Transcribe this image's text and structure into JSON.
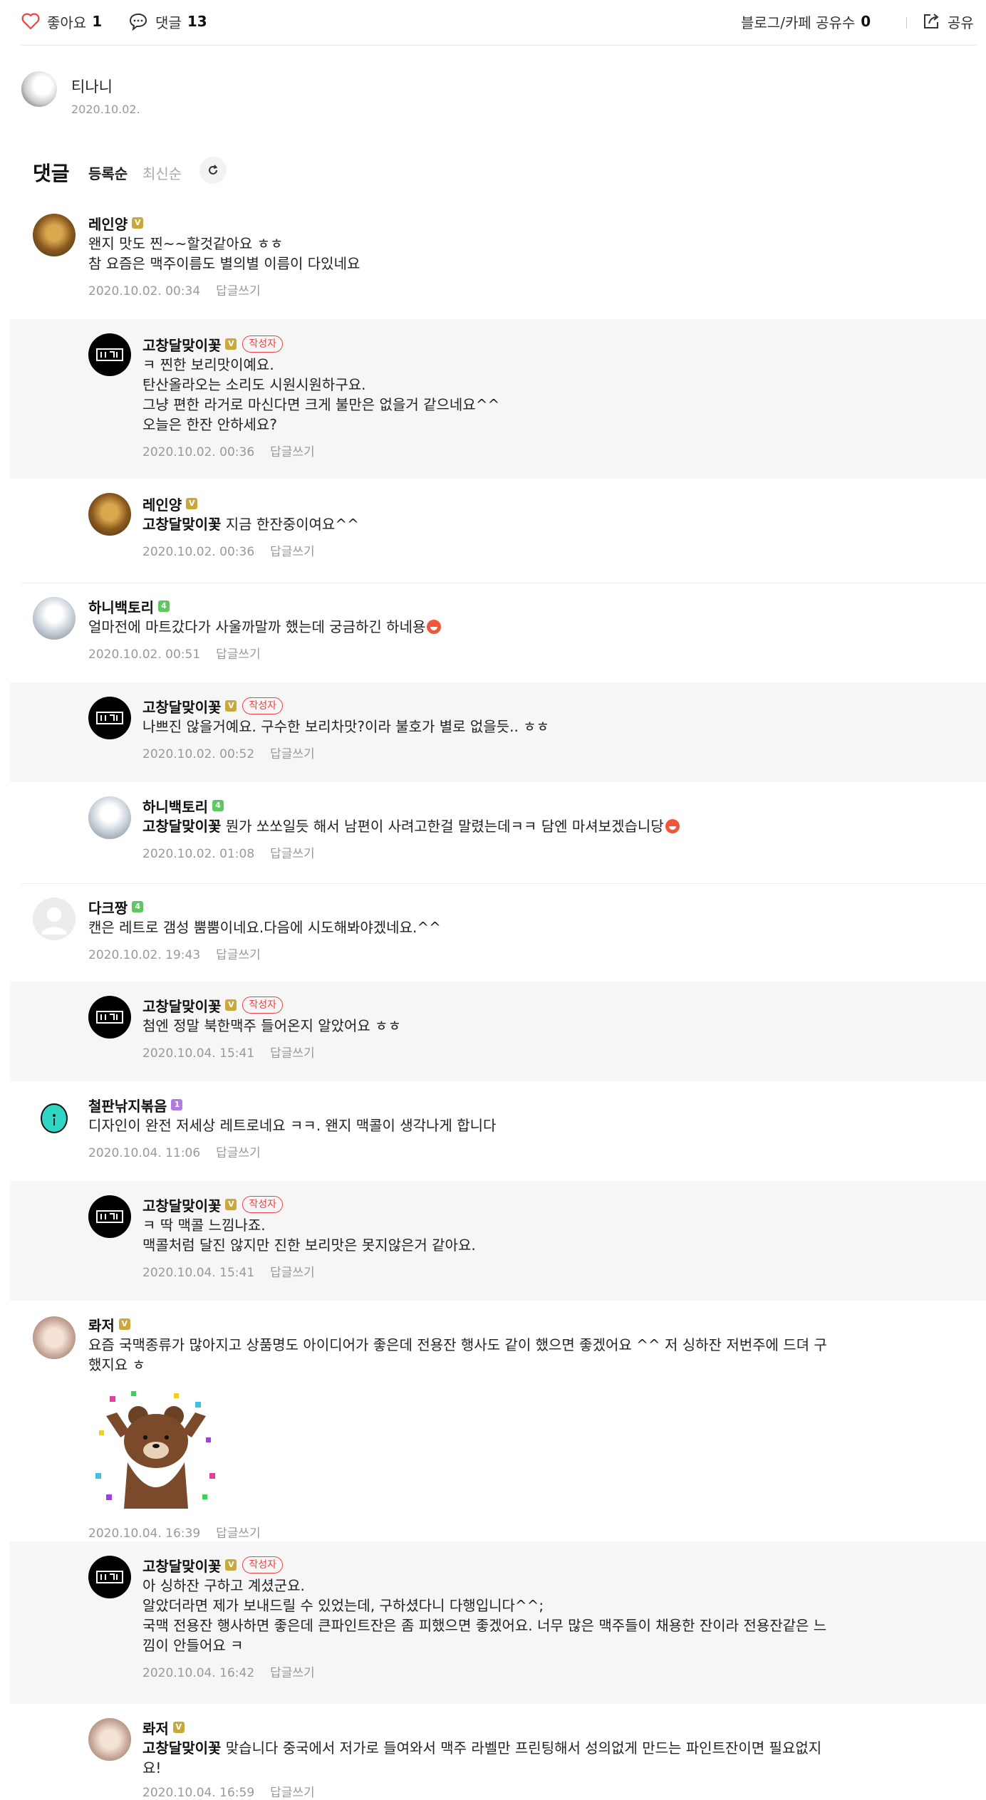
{
  "top": {
    "like_label": "좋아요",
    "like_count": "1",
    "comment_label": "댓글",
    "comment_count": "13",
    "share_label": "블로그/카페 공유수",
    "share_count": "0",
    "share_button": "공유"
  },
  "author": {
    "name": "티나니",
    "date": "2020.10.02."
  },
  "comments_header": {
    "title": "댓글",
    "sort_registered": "등록순",
    "sort_latest": "최신순"
  },
  "reply_label": "답글쓰기",
  "author_tag": "작성자",
  "comments": [
    {
      "name": "레인양",
      "badge": "V",
      "text": "왠지 맛도 찐~~할것같아요 ㅎㅎ\n참 요즘은 맥주이름도 별의별 이름이 다있네요",
      "date": "2020.10.02. 00:34"
    },
    {
      "name": "고창달맞이꽃",
      "badge": "V",
      "text": "ㅋ 찐한 보리맛이예요.\n탄산올라오는 소리도 시원시원하구요.\n그냥 편한 라거로 마신다면 크게 불만은 없을거 같으네요^^\n오늘은 한잔 안하세요?",
      "date": "2020.10.02. 00:36"
    },
    {
      "name": "레인양",
      "badge": "V",
      "mention": "고창달맞이꽃",
      "text": "지금 한잔중이여요^^",
      "date": "2020.10.02. 00:36"
    },
    {
      "name": "하니백토리",
      "badge": "4",
      "text": "얼마전에 마트갔다가 사울까말까 했는데 궁금하긴 하네용",
      "date": "2020.10.02. 00:51"
    },
    {
      "name": "고창달맞이꽃",
      "badge": "V",
      "text": "나쁘진 않을거예요. 구수한 보리차맛?이라 불호가 별로 없을듯.. ㅎㅎ",
      "date": "2020.10.02. 00:52"
    },
    {
      "name": "하니백토리",
      "badge": "4",
      "mention": "고창달맞이꽃",
      "text": "뭔가 쏘쏘일듯 해서 남편이 사려고한걸 말렸는데ㅋㅋ 담엔 마셔보겠습니당",
      "date": "2020.10.02. 01:08"
    },
    {
      "name": "다크짱",
      "badge": "4",
      "text": "캔은 레트로 갬성 뿜뿜이네요.다음에 시도해봐야겠네요.^^",
      "date": "2020.10.02. 19:43"
    },
    {
      "name": "고창달맞이꽃",
      "badge": "V",
      "text": "첨엔 정말 북한맥주 들어온지 알았어요 ㅎㅎ",
      "date": "2020.10.04. 15:41"
    },
    {
      "name": "철판낚지볶음",
      "badge": "1",
      "text": "디자인이 완전 저세상 레트로네요 ㅋㅋ. 왠지 맥콜이 생각나게 합니다",
      "date": "2020.10.04. 11:06"
    },
    {
      "name": "고창달맞이꽃",
      "badge": "V",
      "text": "ㅋ 딱 맥콜 느낌나죠.\n맥콜처럼 달진 않지만 진한 보리맛은 못지않은거 같아요.",
      "date": "2020.10.04. 15:41"
    },
    {
      "name": "롸저",
      "badge": "V",
      "text": "요즘 국맥종류가 많아지고 상품명도 아이디어가 좋은데 전용잔 행사도 같이 했으면 좋겠어요 ^^ 저 싱하잔 저번주에 드뎌 구\n했지요 ㅎ",
      "date": "2020.10.04. 16:39"
    },
    {
      "name": "고창달맞이꽃",
      "badge": "V",
      "text": "아 싱하잔 구하고 계셨군요.\n알았더라면 제가 보내드릴 수 있었는데, 구하셨다니 다행입니다^^;\n국맥 전용잔 행사하면 좋은데 큰파인트잔은 좀 피했으면 좋겠어요. 너무 많은 맥주들이 채용한 잔이라 전용잔같은 느\n낌이 안들어요 ㅋ",
      "date": "2020.10.04. 16:42"
    },
    {
      "name": "롸저",
      "badge": "V",
      "mention": "고창달맞이꽃",
      "text": "맞습니다 중국에서 저가로 들여와서 맥주 라벨만 프린팅해서 성의없게 만드는 파인트잔이면 필요없지\n요!",
      "date": "2020.10.04. 16:59"
    }
  ]
}
